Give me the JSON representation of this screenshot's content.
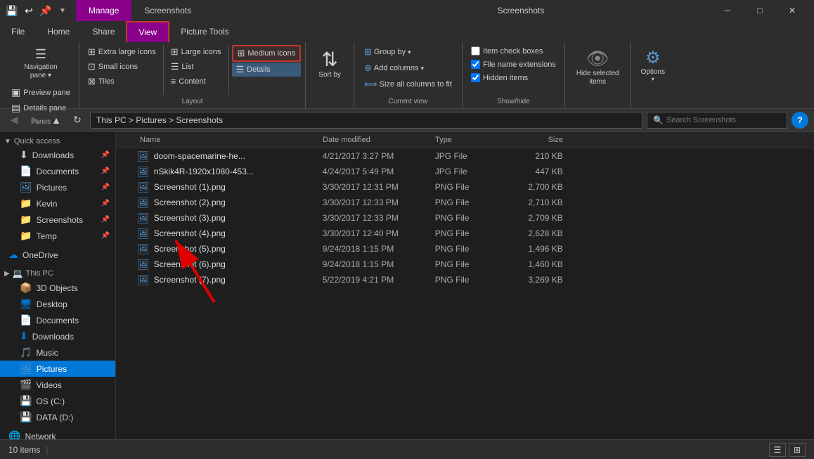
{
  "titlebar": {
    "tabs": [
      {
        "label": "Manage",
        "active": true
      },
      {
        "label": "Screenshots",
        "active": false
      }
    ],
    "window_controls": [
      "─",
      "□",
      "✕"
    ]
  },
  "ribbon_tabs": [
    {
      "label": "File",
      "active": false
    },
    {
      "label": "Home",
      "active": false
    },
    {
      "label": "Share",
      "active": false
    },
    {
      "label": "View",
      "active": true
    },
    {
      "label": "Picture Tools",
      "active": false
    }
  ],
  "ribbon": {
    "panes_section": {
      "label": "Panes",
      "preview_pane": "Preview pane",
      "details_pane": "Details pane",
      "nav_pane": "Navigation\npane"
    },
    "layout_section": {
      "label": "Layout",
      "buttons": [
        {
          "label": "Extra large icons",
          "icon": "⊞"
        },
        {
          "label": "Large icons",
          "icon": "⊞"
        },
        {
          "label": "Medium icons",
          "icon": "⊞",
          "highlighted": true
        },
        {
          "label": "Small icons",
          "icon": "⊞"
        },
        {
          "label": "List",
          "icon": "☰"
        },
        {
          "label": "Details",
          "icon": "☰",
          "selected": true
        },
        {
          "label": "Tiles",
          "icon": "⊡"
        },
        {
          "label": "Content",
          "icon": "≡"
        }
      ]
    },
    "sort_section": {
      "label": "Sort\nby",
      "icon": "⇅"
    },
    "current_view_section": {
      "label": "Current view",
      "group_by": "Group by",
      "add_columns": "Add columns",
      "size_all": "Size all columns to fit"
    },
    "show_hide_section": {
      "label": "Show/hide",
      "item_check_boxes": "Item check boxes",
      "file_name_extensions": "File name extensions",
      "hidden_items": "Hidden items",
      "hide_selected": "Hide selected\nitems"
    },
    "options_section": {
      "label": "",
      "options": "Options"
    }
  },
  "address_bar": {
    "path": "This PC > Pictures > Screenshots",
    "search_placeholder": "Search Screenshots"
  },
  "sidebar": {
    "quick_access": {
      "label": "Quick access",
      "items": [
        {
          "label": "Downloads",
          "icon": "⬇",
          "pinned": true
        },
        {
          "label": "Documents",
          "icon": "📄",
          "pinned": true
        },
        {
          "label": "Pictures",
          "icon": "🖼",
          "pinned": true
        },
        {
          "label": "Kevin",
          "icon": "📁",
          "pinned": true
        },
        {
          "label": "Screenshots",
          "icon": "📁",
          "pinned": true
        },
        {
          "label": "Temp",
          "icon": "📁",
          "pinned": true
        }
      ]
    },
    "onedrive": {
      "label": "OneDrive",
      "icon": "☁"
    },
    "this_pc": {
      "label": "This PC",
      "icon": "💻",
      "items": [
        {
          "label": "3D Objects",
          "icon": "📦"
        },
        {
          "label": "Desktop",
          "icon": "🖥"
        },
        {
          "label": "Documents",
          "icon": "📄"
        },
        {
          "label": "Downloads",
          "icon": "⬇"
        },
        {
          "label": "Music",
          "icon": "🎵"
        },
        {
          "label": "Pictures",
          "icon": "🖼",
          "active": true
        },
        {
          "label": "Videos",
          "icon": "🎬"
        },
        {
          "label": "OS (C:)",
          "icon": "💾"
        },
        {
          "label": "DATA (D:)",
          "icon": "💾"
        }
      ]
    },
    "network": {
      "label": "Network",
      "icon": "🌐"
    }
  },
  "file_list": {
    "headers": [
      "Name",
      "Date modified",
      "Type",
      "Size"
    ],
    "files": [
      {
        "name": "doom-spacemarine-he...",
        "date": "4/21/2017 3:27 PM",
        "type": "JPG File",
        "size": "210 KB"
      },
      {
        "name": "nSkik4R-1920x1080-453...",
        "date": "4/24/2017 5:49 PM",
        "type": "JPG File",
        "size": "447 KB"
      },
      {
        "name": "Screenshot (1).png",
        "date": "3/30/2017 12:31 PM",
        "type": "PNG File",
        "size": "2,700 KB"
      },
      {
        "name": "Screenshot (2).png",
        "date": "3/30/2017 12:33 PM",
        "type": "PNG File",
        "size": "2,710 KB"
      },
      {
        "name": "Screenshot (3).png",
        "date": "3/30/2017 12:33 PM",
        "type": "PNG File",
        "size": "2,709 KB"
      },
      {
        "name": "Screenshot (4).png",
        "date": "3/30/2017 12:40 PM",
        "type": "PNG File",
        "size": "2,628 KB"
      },
      {
        "name": "Screenshot (5).png",
        "date": "9/24/2018 1:15 PM",
        "type": "PNG File",
        "size": "1,496 KB"
      },
      {
        "name": "Screenshot (6).png",
        "date": "9/24/2018 1:15 PM",
        "type": "PNG File",
        "size": "1,460 KB"
      },
      {
        "name": "Screenshot (7).png",
        "date": "5/22/2019 4:21 PM",
        "type": "PNG File",
        "size": "3,269 KB"
      }
    ]
  },
  "status_bar": {
    "count": "10 items",
    "separator": "|"
  }
}
